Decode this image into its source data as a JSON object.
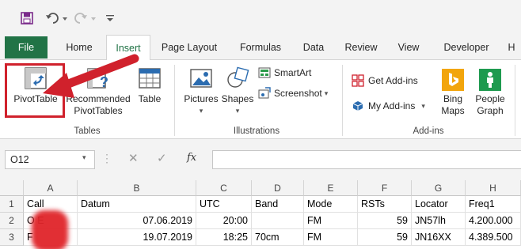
{
  "tabs": [
    "File",
    "Home",
    "Insert",
    "Page Layout",
    "Formulas",
    "Data",
    "Review",
    "View",
    "Developer",
    "H"
  ],
  "ribbon": {
    "pivottable": "PivotTable",
    "recommended_line1": "Recommended",
    "recommended_line2": "PivotTables",
    "table": "Table",
    "pictures": "Pictures",
    "shapes": "Shapes",
    "smartart": "SmartArt",
    "screenshot": "Screenshot",
    "screenshot_caret": "▾",
    "get_addins": "Get Add-ins",
    "my_addins": "My Add-ins",
    "my_addins_caret": "▾",
    "bing_line1": "Bing",
    "bing_line2": "Maps",
    "people_line1": "People",
    "people_line2": "Graph",
    "groups": {
      "tables": "Tables",
      "illustrations": "Illustrations",
      "addins": "Add-ins"
    }
  },
  "formula_bar": {
    "name_box": "O12",
    "fx": "fx"
  },
  "columns": [
    "A",
    "B",
    "C",
    "D",
    "E",
    "F",
    "G",
    "H"
  ],
  "rows": [
    {
      "num": "1",
      "cells": [
        "Call",
        "Datum",
        "UTC",
        "Band",
        "Mode",
        "RSTs",
        "Locator",
        "Freq1"
      ]
    },
    {
      "num": "2",
      "cells": [
        "O      E",
        "07.06.2019",
        "20:00",
        "",
        "FM",
        "59",
        "JN57lh",
        "4.200.000"
      ]
    },
    {
      "num": "3",
      "cells": [
        "F",
        "19.07.2019",
        "18:25",
        "70cm",
        "FM",
        "59",
        "JN16XX",
        "4.389.500"
      ]
    }
  ],
  "colors": {
    "accent": "#217346",
    "highlight": "#d0212c"
  }
}
